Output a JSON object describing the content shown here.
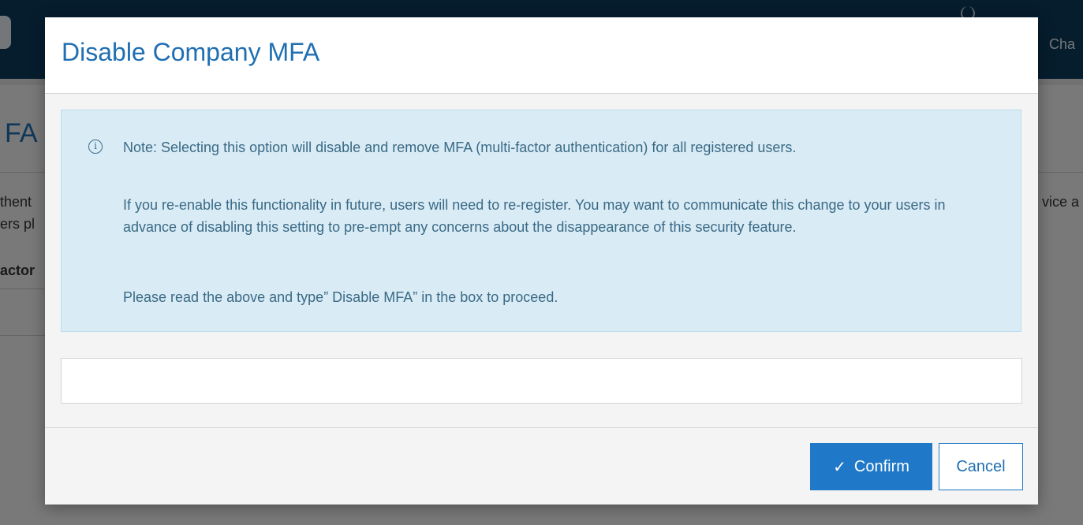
{
  "background": {
    "header_link": "Cha",
    "page_title": "FA",
    "fragments_left": [
      "thent",
      "ers pl",
      "actor"
    ],
    "fragment_right": "vice a"
  },
  "dialog": {
    "title": "Disable Company MFA",
    "info_icon": "info-circle-icon",
    "note_paragraphs": [
      "Note: Selecting this option will disable and remove MFA (multi-factor authentication) for all registered users.",
      "If you re-enable this functionality in future, users will need to re-register. You may want to communicate this change to your users in advance of disabling this setting to pre-empt any concerns about the disappearance of this security feature.",
      "Please read the above and type” Disable MFA” in the box to proceed."
    ],
    "input_value": "",
    "confirm_label": "Confirm",
    "confirm_icon": "check-icon",
    "cancel_label": "Cancel"
  },
  "colors": {
    "title_blue": "#1f6fb2",
    "note_background": "#d9ebf5",
    "note_text": "#3a6a85",
    "primary_button": "#1f78c8",
    "app_header": "#0d3a5c"
  }
}
